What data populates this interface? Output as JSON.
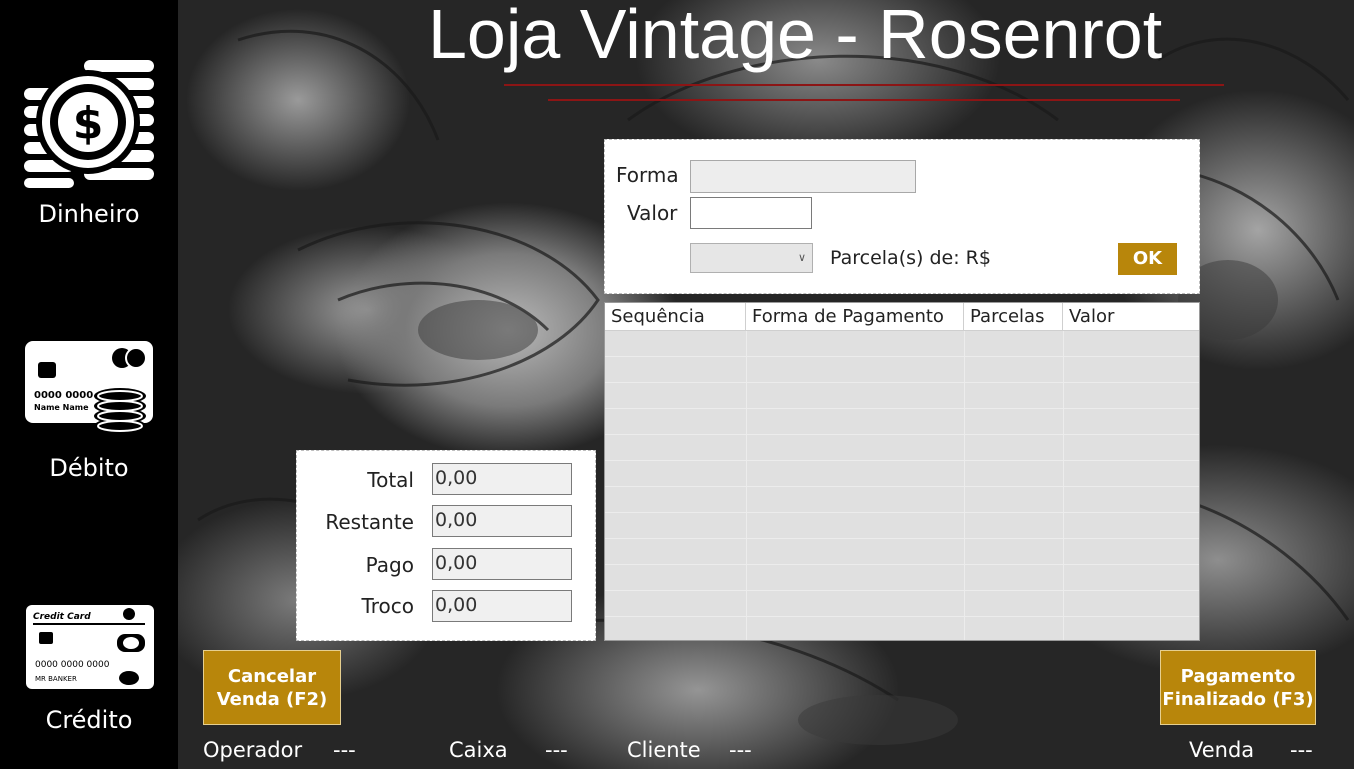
{
  "header": {
    "title": "Loja Vintage - Rosenrot"
  },
  "sidebar": {
    "items": [
      {
        "label": "Dinheiro",
        "icon": "cash-coins-icon"
      },
      {
        "label": "Débito",
        "icon": "debit-card-icon"
      },
      {
        "label": "Crédito",
        "icon": "credit-card-icon"
      }
    ],
    "credit_card": {
      "brand": "Credit Card",
      "number": "0000 0000 0000",
      "holder": "MR BANKER"
    },
    "debit_card": {
      "number": "0000 0000",
      "name": "Name Name"
    }
  },
  "payment_form": {
    "forma_label": "Forma",
    "forma_value": "",
    "valor_label": "Valor",
    "valor_value": "",
    "parcelas_selected": "",
    "parcelas_label": "Parcela(s) de: R$",
    "ok_label": "OK"
  },
  "payments_table": {
    "columns": [
      "Sequência",
      "Forma de Pagamento",
      "Parcelas",
      "Valor"
    ],
    "rows": []
  },
  "totals": {
    "total_label": "Total",
    "total_value": "0,00",
    "restante_label": "Restante",
    "restante_value": "0,00",
    "pago_label": "Pago",
    "pago_value": "0,00",
    "troco_label": "Troco",
    "troco_value": "0,00"
  },
  "actions": {
    "cancel_line1": "Cancelar",
    "cancel_line2": "Venda (F2)",
    "finish_line1": "Pagamento",
    "finish_line2": "Finalizado (F3)"
  },
  "status_bar": {
    "operador_label": "Operador",
    "operador_value": "---",
    "caixa_label": "Caixa",
    "caixa_value": "---",
    "cliente_label": "Cliente",
    "cliente_value": "---",
    "venda_label": "Venda",
    "venda_value": "---"
  },
  "colors": {
    "accent": "#b8860b",
    "title_line": "#8c1515",
    "sidebar": "#000000"
  }
}
